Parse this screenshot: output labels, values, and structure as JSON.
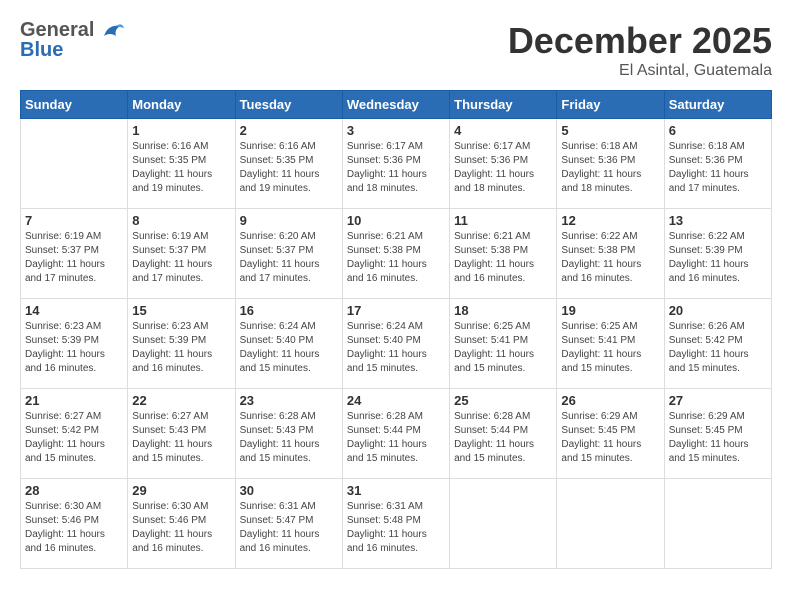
{
  "app": {
    "logo_general": "General",
    "logo_blue": "Blue",
    "month_title": "December 2025",
    "subtitle": "El Asintal, Guatemala"
  },
  "calendar": {
    "headers": [
      "Sunday",
      "Monday",
      "Tuesday",
      "Wednesday",
      "Thursday",
      "Friday",
      "Saturday"
    ],
    "weeks": [
      [
        {
          "day": "",
          "info": ""
        },
        {
          "day": "1",
          "info": "Sunrise: 6:16 AM\nSunset: 5:35 PM\nDaylight: 11 hours\nand 19 minutes."
        },
        {
          "day": "2",
          "info": "Sunrise: 6:16 AM\nSunset: 5:35 PM\nDaylight: 11 hours\nand 19 minutes."
        },
        {
          "day": "3",
          "info": "Sunrise: 6:17 AM\nSunset: 5:36 PM\nDaylight: 11 hours\nand 18 minutes."
        },
        {
          "day": "4",
          "info": "Sunrise: 6:17 AM\nSunset: 5:36 PM\nDaylight: 11 hours\nand 18 minutes."
        },
        {
          "day": "5",
          "info": "Sunrise: 6:18 AM\nSunset: 5:36 PM\nDaylight: 11 hours\nand 18 minutes."
        },
        {
          "day": "6",
          "info": "Sunrise: 6:18 AM\nSunset: 5:36 PM\nDaylight: 11 hours\nand 17 minutes."
        }
      ],
      [
        {
          "day": "7",
          "info": "Sunrise: 6:19 AM\nSunset: 5:37 PM\nDaylight: 11 hours\nand 17 minutes."
        },
        {
          "day": "8",
          "info": "Sunrise: 6:19 AM\nSunset: 5:37 PM\nDaylight: 11 hours\nand 17 minutes."
        },
        {
          "day": "9",
          "info": "Sunrise: 6:20 AM\nSunset: 5:37 PM\nDaylight: 11 hours\nand 17 minutes."
        },
        {
          "day": "10",
          "info": "Sunrise: 6:21 AM\nSunset: 5:38 PM\nDaylight: 11 hours\nand 16 minutes."
        },
        {
          "day": "11",
          "info": "Sunrise: 6:21 AM\nSunset: 5:38 PM\nDaylight: 11 hours\nand 16 minutes."
        },
        {
          "day": "12",
          "info": "Sunrise: 6:22 AM\nSunset: 5:38 PM\nDaylight: 11 hours\nand 16 minutes."
        },
        {
          "day": "13",
          "info": "Sunrise: 6:22 AM\nSunset: 5:39 PM\nDaylight: 11 hours\nand 16 minutes."
        }
      ],
      [
        {
          "day": "14",
          "info": "Sunrise: 6:23 AM\nSunset: 5:39 PM\nDaylight: 11 hours\nand 16 minutes."
        },
        {
          "day": "15",
          "info": "Sunrise: 6:23 AM\nSunset: 5:39 PM\nDaylight: 11 hours\nand 16 minutes."
        },
        {
          "day": "16",
          "info": "Sunrise: 6:24 AM\nSunset: 5:40 PM\nDaylight: 11 hours\nand 15 minutes."
        },
        {
          "day": "17",
          "info": "Sunrise: 6:24 AM\nSunset: 5:40 PM\nDaylight: 11 hours\nand 15 minutes."
        },
        {
          "day": "18",
          "info": "Sunrise: 6:25 AM\nSunset: 5:41 PM\nDaylight: 11 hours\nand 15 minutes."
        },
        {
          "day": "19",
          "info": "Sunrise: 6:25 AM\nSunset: 5:41 PM\nDaylight: 11 hours\nand 15 minutes."
        },
        {
          "day": "20",
          "info": "Sunrise: 6:26 AM\nSunset: 5:42 PM\nDaylight: 11 hours\nand 15 minutes."
        }
      ],
      [
        {
          "day": "21",
          "info": "Sunrise: 6:27 AM\nSunset: 5:42 PM\nDaylight: 11 hours\nand 15 minutes."
        },
        {
          "day": "22",
          "info": "Sunrise: 6:27 AM\nSunset: 5:43 PM\nDaylight: 11 hours\nand 15 minutes."
        },
        {
          "day": "23",
          "info": "Sunrise: 6:28 AM\nSunset: 5:43 PM\nDaylight: 11 hours\nand 15 minutes."
        },
        {
          "day": "24",
          "info": "Sunrise: 6:28 AM\nSunset: 5:44 PM\nDaylight: 11 hours\nand 15 minutes."
        },
        {
          "day": "25",
          "info": "Sunrise: 6:28 AM\nSunset: 5:44 PM\nDaylight: 11 hours\nand 15 minutes."
        },
        {
          "day": "26",
          "info": "Sunrise: 6:29 AM\nSunset: 5:45 PM\nDaylight: 11 hours\nand 15 minutes."
        },
        {
          "day": "27",
          "info": "Sunrise: 6:29 AM\nSunset: 5:45 PM\nDaylight: 11 hours\nand 15 minutes."
        }
      ],
      [
        {
          "day": "28",
          "info": "Sunrise: 6:30 AM\nSunset: 5:46 PM\nDaylight: 11 hours\nand 16 minutes."
        },
        {
          "day": "29",
          "info": "Sunrise: 6:30 AM\nSunset: 5:46 PM\nDaylight: 11 hours\nand 16 minutes."
        },
        {
          "day": "30",
          "info": "Sunrise: 6:31 AM\nSunset: 5:47 PM\nDaylight: 11 hours\nand 16 minutes."
        },
        {
          "day": "31",
          "info": "Sunrise: 6:31 AM\nSunset: 5:48 PM\nDaylight: 11 hours\nand 16 minutes."
        },
        {
          "day": "",
          "info": ""
        },
        {
          "day": "",
          "info": ""
        },
        {
          "day": "",
          "info": ""
        }
      ]
    ]
  }
}
